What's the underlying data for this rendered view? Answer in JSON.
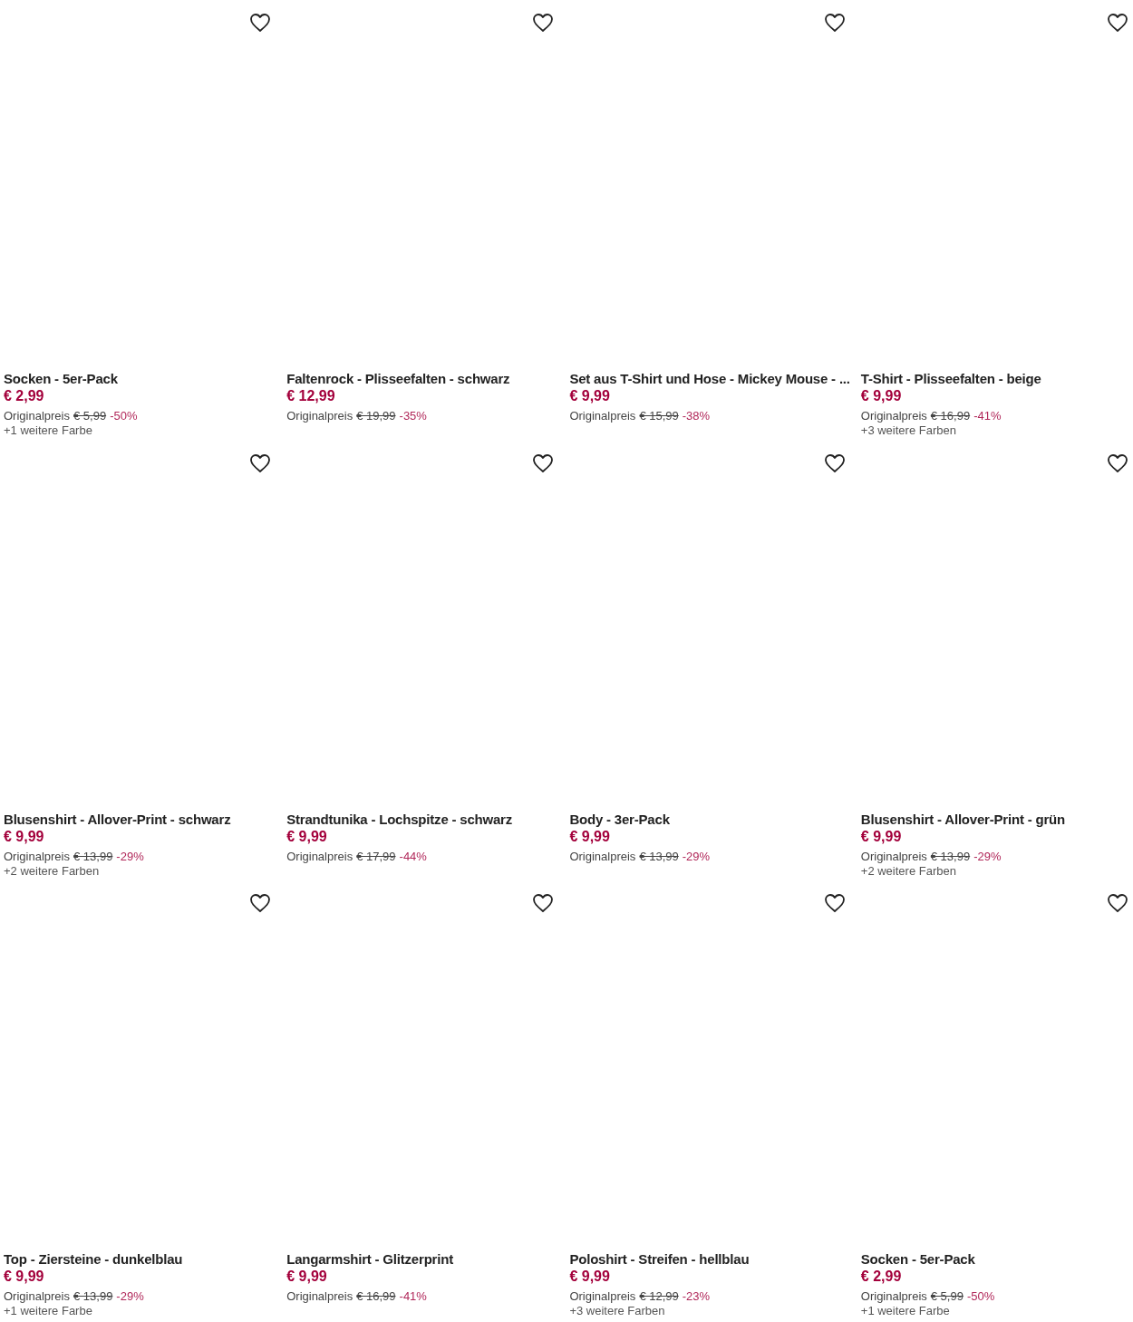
{
  "products": [
    {
      "title": "Socken - 5er-Pack",
      "price": "€ 2,99",
      "original_label": "Originalpreis",
      "original_price": "€ 5,99",
      "discount": "-50%",
      "colors": "+1 weitere Farbe"
    },
    {
      "title": "Faltenrock - Plisseefalten - schwarz",
      "price": "€ 12,99",
      "original_label": "Originalpreis",
      "original_price": "€ 19,99",
      "discount": "-35%"
    },
    {
      "title": "Set aus T-Shirt und Hose - Mickey Mouse - ...",
      "price": "€ 9,99",
      "original_label": "Originalpreis",
      "original_price": "€ 15,99",
      "discount": "-38%"
    },
    {
      "title": "T-Shirt - Plisseefalten - beige",
      "price": "€ 9,99",
      "original_label": "Originalpreis",
      "original_price": "€ 16,99",
      "discount": "-41%",
      "colors": "+3 weitere Farben"
    },
    {
      "title": "Blusenshirt - Allover-Print - schwarz",
      "price": "€ 9,99",
      "original_label": "Originalpreis",
      "original_price": "€ 13,99",
      "discount": "-29%",
      "colors": "+2 weitere Farben"
    },
    {
      "title": "Strandtunika - Lochspitze - schwarz",
      "price": "€ 9,99",
      "original_label": "Originalpreis",
      "original_price": "€ 17,99",
      "discount": "-44%"
    },
    {
      "title": "Body - 3er-Pack",
      "price": "€ 9,99",
      "original_label": "Originalpreis",
      "original_price": "€ 13,99",
      "discount": "-29%"
    },
    {
      "title": "Blusenshirt - Allover-Print - grün",
      "price": "€ 9,99",
      "original_label": "Originalpreis",
      "original_price": "€ 13,99",
      "discount": "-29%",
      "colors": "+2 weitere Farben"
    },
    {
      "title": "Top - Ziersteine - dunkelblau",
      "price": "€ 9,99",
      "original_label": "Originalpreis",
      "original_price": "€ 13,99",
      "discount": "-29%",
      "colors": "+1 weitere Farbe"
    },
    {
      "title": "Langarmshirt - Glitzerprint",
      "price": "€ 9,99",
      "original_label": "Originalpreis",
      "original_price": "€ 16,99",
      "discount": "-41%"
    },
    {
      "title": "Poloshirt - Streifen - hellblau",
      "price": "€ 9,99",
      "original_label": "Originalpreis",
      "original_price": "€ 12,99",
      "discount": "-23%",
      "colors": "+3 weitere Farben"
    },
    {
      "title": "Socken - 5er-Pack",
      "price": "€ 2,99",
      "original_label": "Originalpreis",
      "original_price": "€ 5,99",
      "discount": "-50%",
      "colors": "+1 weitere Farbe"
    }
  ]
}
